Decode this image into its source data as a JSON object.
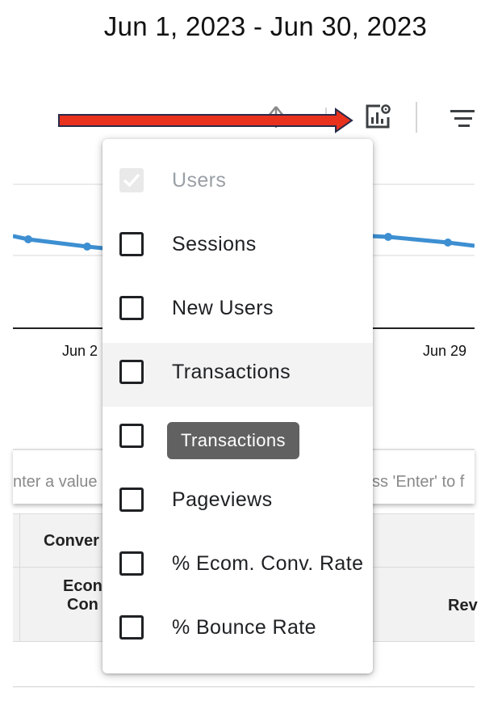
{
  "header": {
    "date_range": "Jun 1, 2023 - Jun 30, 2023"
  },
  "toolbar": {
    "icons": [
      "sort-icon",
      "chart-settings-icon",
      "filter-icon"
    ],
    "annotation_color": "#e8321e"
  },
  "chart": {
    "line_color": "#3d8fd1",
    "x_ticks": [
      "Jun 2",
      "Jun 29"
    ]
  },
  "table": {
    "filter_placeholder_left": "nter a value",
    "filter_placeholder_right": "ss 'Enter' to f",
    "group_header": "Conver",
    "col_header_1_line1": "Econ",
    "col_header_1_line2": "Con",
    "col_header_2": "Rev"
  },
  "menu": {
    "items": [
      {
        "label": "Users",
        "checked": true,
        "disabled": true
      },
      {
        "label": "Sessions",
        "checked": false
      },
      {
        "label": "New Users",
        "checked": false
      },
      {
        "label": "Transactions",
        "checked": false,
        "hovered": true
      },
      {
        "label": "",
        "checked": false,
        "tooltip": "Transactions"
      },
      {
        "label": "Pageviews",
        "checked": false
      },
      {
        "label": "% Ecom. Conv. Rate",
        "checked": false
      },
      {
        "label": "% Bounce Rate",
        "checked": false
      }
    ]
  }
}
